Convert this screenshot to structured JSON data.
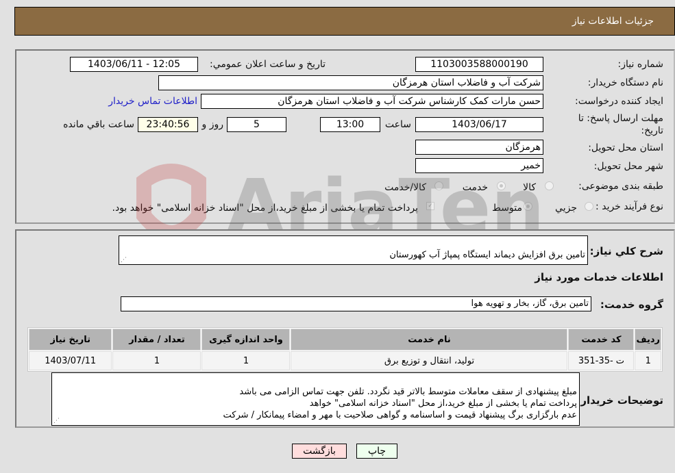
{
  "header": {
    "title": "جزئیات اطلاعات نیاز"
  },
  "fields": {
    "need_number": {
      "label": "شماره نیاز:",
      "value": "1103003588000190"
    },
    "announce_datetime": {
      "label": "تاریخ و ساعت اعلان عمومي:",
      "value": "1403/06/11 - 12:05"
    },
    "buyer_org": {
      "label": "نام دستگاه خریدار:",
      "value": "شرکت آب و فاضلاب استان هرمزگان"
    },
    "requester": {
      "label": "ایجاد کننده درخواست:",
      "value": "حسن مارات کمک کارشناس شرکت آب و فاضلاب استان هرمزگان",
      "contact_link": "اطلاعات تماس خریدار"
    },
    "deadline": {
      "label": "مهلت ارسال پاسخ: تا تاریخ:",
      "date": "1403/06/17",
      "time_label": "ساعت",
      "time": "13:00",
      "days": "5",
      "days_label": "روز و",
      "remaining": "23:40:56",
      "remaining_label": "ساعت باقي مانده"
    },
    "province": {
      "label": "استان محل تحویل:",
      "value": "هرمزگان"
    },
    "city": {
      "label": "شهر محل تحویل:",
      "value": "خمیر"
    },
    "category": {
      "label": "طبقه بندی موضوعی:",
      "options": [
        "کالا",
        "خدمت",
        "کالا/خدمت"
      ],
      "selected": "خدمت"
    },
    "process": {
      "label": "نوع فرآیند خرید :",
      "options": [
        "جزیي",
        "متوسط"
      ],
      "selected": "متوسط",
      "treasury_note": "پرداخت تمام یا بخشی از مبلغ خرید،از محل \"اسناد خزانه اسلامی\" خواهد بود."
    }
  },
  "description": {
    "label": "شرح کلي نیاز:",
    "value": "تامین برق افزایش دیماند ایستگاه پمپاژ آب کهورستان"
  },
  "services_section": {
    "title": "اطلاعات خدمات مورد نیاز"
  },
  "service_group": {
    "label": "گروه خدمت:",
    "value": "تامین برق، گاز، بخار و تهویه هوا"
  },
  "table": {
    "headers": [
      "ردیف",
      "کد خدمت",
      "نام خدمت",
      "واحد اندازه گیری",
      "تعداد / مقدار",
      "تاریخ نیاز"
    ],
    "rows": [
      [
        "1",
        "ت -35-351",
        "تولید، انتقال و توزیع برق",
        "1",
        "1",
        "1403/07/11"
      ]
    ]
  },
  "buyer_notes": {
    "label": "توضیحات خریدار:",
    "value": "مبلغ پیشنهادی از سقف معاملات متوسط بالاتر قید نگردد. تلفن جهت تماس الزامی می باشد\nپرداخت تمام یا بخشی از مبلغ خرید،از محل \"اسناد خزانه اسلامی\" خواهد\nعدم بارگزاری برگ پیشنهاد قیمت و اساسنامه و گواهی صلاحیت با مهر و امضاء پیمانکار / شرکت"
  },
  "buttons": {
    "print": "چاپ",
    "back": "بازگشت"
  },
  "watermark": {
    "text": "AriaTender.neT"
  }
}
